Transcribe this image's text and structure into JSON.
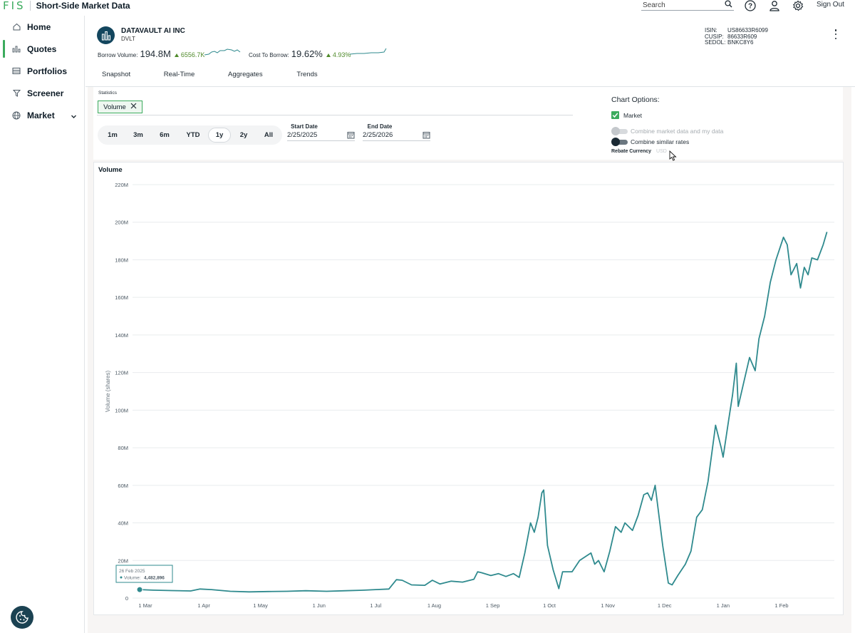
{
  "app": {
    "logo": "FIS",
    "title": "Short-Side Market Data",
    "search_placeholder": "Search",
    "sign_out": "Sign Out"
  },
  "sidebar": {
    "items": [
      {
        "label": "Home",
        "icon": "home-icon"
      },
      {
        "label": "Quotes",
        "icon": "bar-chart-icon"
      },
      {
        "label": "Portfolios",
        "icon": "table-icon"
      },
      {
        "label": "Screener",
        "icon": "filter-icon"
      },
      {
        "label": "Market",
        "icon": "globe-icon"
      }
    ],
    "active": "Quotes"
  },
  "security": {
    "name": "DATAVAULT AI INC",
    "ticker": "DVLT",
    "borrow_volume_label": "Borrow Volume:",
    "borrow_volume_value": "194.8M",
    "borrow_volume_change": "6556.7K",
    "cost_to_borrow_label": "Cost To Borrow:",
    "cost_to_borrow_value": "19.62%",
    "cost_to_borrow_change": "4.93%",
    "isin_label": "ISIN:",
    "isin": "US86633R6099",
    "cusip_label": "CUSIP:",
    "cusip": "86633R609",
    "sedol_label": "SEDOL:",
    "sedol": "BNKC8Y6"
  },
  "tabs": [
    {
      "label": "Snapshot"
    },
    {
      "label": "Real-Time"
    },
    {
      "label": "Aggregates"
    },
    {
      "label": "Trends"
    }
  ],
  "active_tab": "Trends",
  "statistics": {
    "label": "Statistics",
    "chip": "Volume",
    "ranges": [
      "1m",
      "3m",
      "6m",
      "YTD",
      "1y",
      "2y",
      "All"
    ],
    "active_range": "1y",
    "start_date_label": "Start Date",
    "start_date": "2/25/2025",
    "end_date_label": "End Date",
    "end_date": "2/25/2026"
  },
  "chart_options": {
    "title": "Chart Options:",
    "market_label": "Market",
    "market_checked": true,
    "combine_market_label": "Combine market data and my data",
    "combine_market_on": false,
    "combine_similar_label": "Combine similar rates",
    "combine_similar_on": true,
    "rebate_currency_label": "Rebate Currency",
    "rebate_currency_value": "USD"
  },
  "colors": {
    "brand_green": "#3bab5d",
    "line": "#2f8a8e",
    "navy": "#13465e",
    "up_green": "#4f8a2a"
  },
  "tooltip": {
    "date": "26 Feb 2025",
    "label": "Volume:",
    "value": "4,482,896"
  },
  "chart_data": {
    "type": "line",
    "title": "Volume",
    "xlabel": "",
    "ylabel": "Volume (shares)",
    "ylim": [
      0,
      220000000
    ],
    "y_ticks": [
      "0",
      "20M",
      "40M",
      "60M",
      "80M",
      "100M",
      "120M",
      "140M",
      "160M",
      "180M",
      "200M",
      "220M"
    ],
    "x_ticks": [
      "1 Mar",
      "1 Apr",
      "1 May",
      "1 Jun",
      "1 Jul",
      "1 Aug",
      "1 Sep",
      "1 Oct",
      "1 Nov",
      "1 Dec",
      "1 Jan",
      "1 Feb"
    ],
    "grid": true,
    "series": [
      {
        "points": [
          [
            "2025-02-26",
            4.5
          ],
          [
            "2025-03-05",
            4.2
          ],
          [
            "2025-03-15",
            4.0
          ],
          [
            "2025-03-25",
            3.8
          ],
          [
            "2025-03-30",
            4.8
          ],
          [
            "2025-04-05",
            4.5
          ],
          [
            "2025-04-15",
            3.6
          ],
          [
            "2025-04-25",
            3.3
          ],
          [
            "2025-05-05",
            3.5
          ],
          [
            "2025-05-15",
            3.6
          ],
          [
            "2025-05-25",
            3.9
          ],
          [
            "2025-06-05",
            3.6
          ],
          [
            "2025-06-15",
            3.9
          ],
          [
            "2025-06-25",
            4.2
          ],
          [
            "2025-07-01",
            4.5
          ],
          [
            "2025-07-08",
            4.8
          ],
          [
            "2025-07-12",
            9.8
          ],
          [
            "2025-07-15",
            9.5
          ],
          [
            "2025-07-20",
            7.0
          ],
          [
            "2025-07-27",
            6.8
          ],
          [
            "2025-07-31",
            9.5
          ],
          [
            "2025-08-04",
            7.5
          ],
          [
            "2025-08-10",
            9.0
          ],
          [
            "2025-08-16",
            8.5
          ],
          [
            "2025-08-22",
            10.0
          ],
          [
            "2025-08-24",
            14.0
          ],
          [
            "2025-08-26",
            13.5
          ],
          [
            "2025-08-31",
            12.0
          ],
          [
            "2025-09-04",
            13.0
          ],
          [
            "2025-09-08",
            11.5
          ],
          [
            "2025-09-12",
            13.0
          ],
          [
            "2025-09-15",
            11.0
          ],
          [
            "2025-09-18",
            24.0
          ],
          [
            "2025-09-21",
            40.0
          ],
          [
            "2025-09-23",
            35.0
          ],
          [
            "2025-09-25",
            43.0
          ],
          [
            "2025-09-27",
            56.0
          ],
          [
            "2025-09-28",
            57.5
          ],
          [
            "2025-09-30",
            28.0
          ],
          [
            "2025-10-03",
            15.0
          ],
          [
            "2025-10-06",
            5.0
          ],
          [
            "2025-10-08",
            14.0
          ],
          [
            "2025-10-13",
            14.0
          ],
          [
            "2025-10-17",
            20.0
          ],
          [
            "2025-10-20",
            22.0
          ],
          [
            "2025-10-23",
            24.0
          ],
          [
            "2025-10-25",
            18.0
          ],
          [
            "2025-10-27",
            20.0
          ],
          [
            "2025-10-30",
            14.0
          ],
          [
            "2025-11-02",
            25.0
          ],
          [
            "2025-11-05",
            38.0
          ],
          [
            "2025-11-08",
            35.0
          ],
          [
            "2025-11-10",
            40.0
          ],
          [
            "2025-11-14",
            36.0
          ],
          [
            "2025-11-17",
            44.0
          ],
          [
            "2025-11-20",
            55.0
          ],
          [
            "2025-11-22",
            56.0
          ],
          [
            "2025-11-24",
            52.0
          ],
          [
            "2025-11-26",
            60.0
          ],
          [
            "2025-11-30",
            28.0
          ],
          [
            "2025-12-03",
            8.0
          ],
          [
            "2025-12-05",
            7.0
          ],
          [
            "2025-12-08",
            12.0
          ],
          [
            "2025-12-12",
            18.0
          ],
          [
            "2025-12-15",
            25.0
          ],
          [
            "2025-12-18",
            43.0
          ],
          [
            "2025-12-21",
            47.0
          ],
          [
            "2025-12-24",
            62.0
          ],
          [
            "2025-12-28",
            92.0
          ],
          [
            "2025-12-31",
            80.0
          ],
          [
            "2026-01-01",
            75.0
          ],
          [
            "2026-01-04",
            95.0
          ],
          [
            "2026-01-06",
            108.0
          ],
          [
            "2026-01-08",
            125.0
          ],
          [
            "2026-01-09",
            102.0
          ],
          [
            "2026-01-12",
            115.0
          ],
          [
            "2026-01-15",
            128.0
          ],
          [
            "2026-01-18",
            121.0
          ],
          [
            "2026-01-20",
            138.0
          ],
          [
            "2026-01-23",
            150.0
          ],
          [
            "2026-01-26",
            168.0
          ],
          [
            "2026-01-29",
            180.0
          ],
          [
            "2026-02-02",
            192.0
          ],
          [
            "2026-02-04",
            188.0
          ],
          [
            "2026-02-06",
            172.0
          ],
          [
            "2026-02-09",
            178.0
          ],
          [
            "2026-02-11",
            165.0
          ],
          [
            "2026-02-13",
            176.0
          ],
          [
            "2026-02-15",
            172.0
          ],
          [
            "2026-02-17",
            181.0
          ],
          [
            "2026-02-20",
            180.0
          ],
          [
            "2026-02-23",
            188.0
          ],
          [
            "2026-02-25",
            194.8
          ]
        ],
        "unit": "M shares"
      }
    ]
  }
}
